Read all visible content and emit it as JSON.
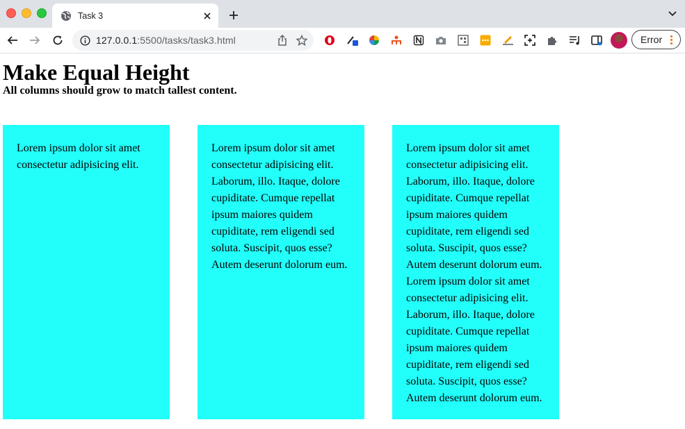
{
  "browser": {
    "tab": {
      "title": "Task 3"
    },
    "address_bar": {
      "host": "127.0.0.1",
      "rest": ":5500/tasks/task3.html"
    },
    "profile_button": {
      "label": "Error"
    }
  },
  "page": {
    "title": "Make Equal Height",
    "subtitle": "All columns should grow to match tallest content.",
    "columns": [
      {
        "text": "Lorem ipsum dolor sit amet consectetur adipisicing elit."
      },
      {
        "text": "Lorem ipsum dolor sit amet consectetur adipisicing elit. Laborum, illo. Itaque, dolore cupiditate. Cumque repellat ipsum maiores quidem cupiditate, rem eligendi sed soluta. Suscipit, quos esse? Autem deserunt dolorum eum."
      },
      {
        "text": "Lorem ipsum dolor sit amet consectetur adipisicing elit. Laborum, illo. Itaque, dolore cupiditate. Cumque repellat ipsum maiores quidem cupiditate, rem eligendi sed soluta. Suscipit, quos esse? Autem deserunt dolorum eum. Lorem ipsum dolor sit amet consectetur adipisicing elit. Laborum, illo. Itaque, dolore cupiditate. Cumque repellat ipsum maiores quidem cupiditate, rem eligendi sed soluta. Suscipit, quos esse? Autem deserunt dolorum eum."
      }
    ],
    "column_color": "#22fffa"
  }
}
